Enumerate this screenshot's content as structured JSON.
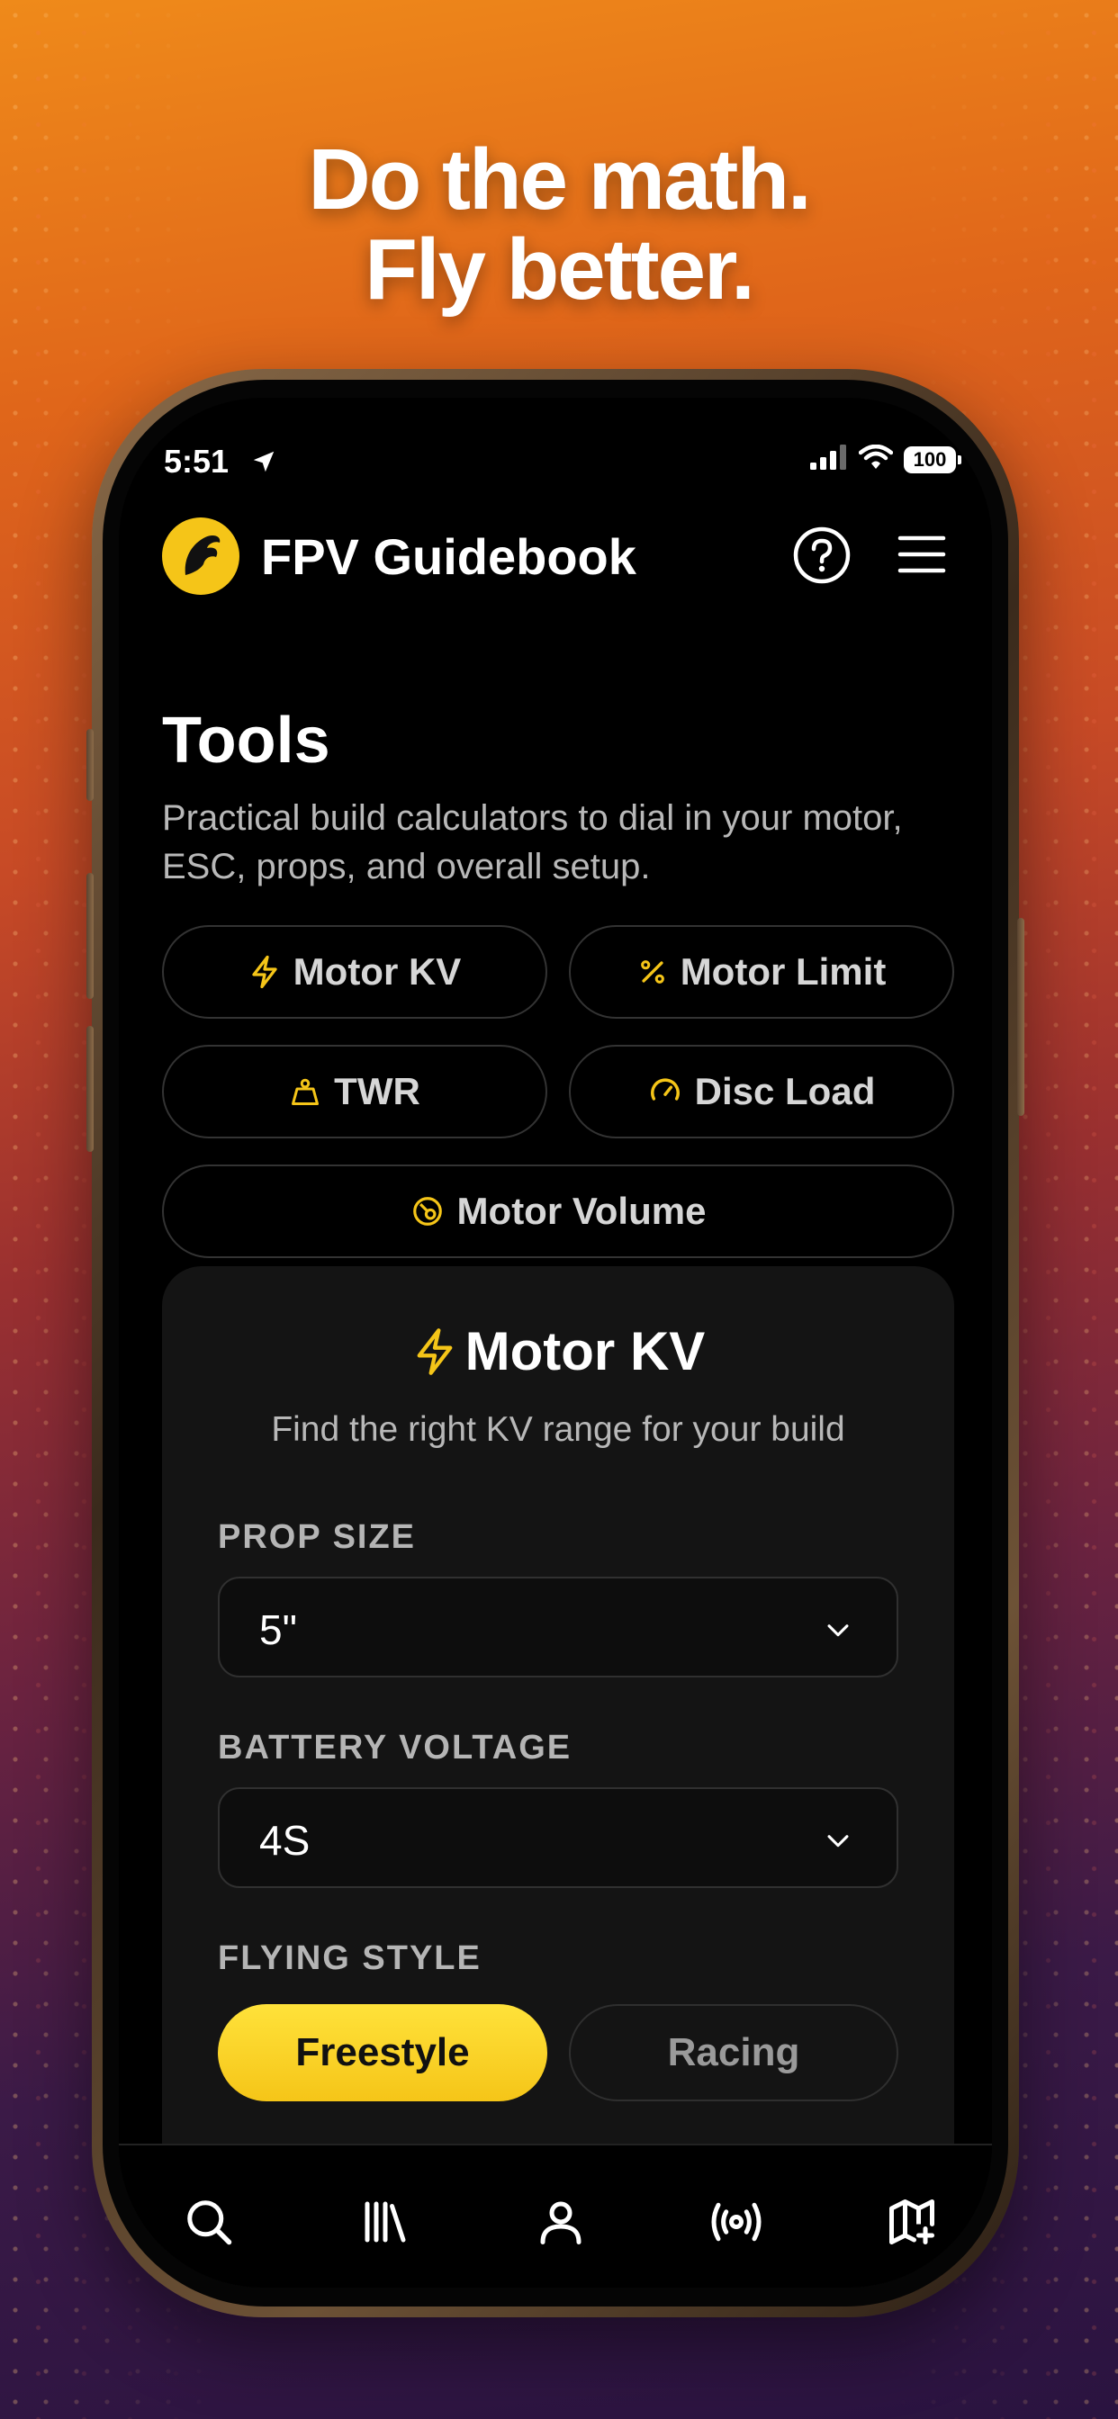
{
  "headline": {
    "line1": "Do the math.",
    "line2": "Fly better."
  },
  "status_bar": {
    "time": "5:51",
    "battery": "100"
  },
  "app_bar": {
    "title": "FPV Guidebook"
  },
  "page": {
    "title": "Tools",
    "description": "Practical build calculators to dial in your motor, ESC, props, and overall setup."
  },
  "tool_chips": [
    {
      "label": "Motor KV",
      "icon": "bolt-icon"
    },
    {
      "label": "Motor Limit",
      "icon": "percent-icon"
    },
    {
      "label": "TWR",
      "icon": "weight-icon"
    },
    {
      "label": "Disc Load",
      "icon": "gauge-icon"
    },
    {
      "label": "Motor Volume",
      "icon": "motor-icon"
    }
  ],
  "calculator": {
    "title": "Motor KV",
    "subtitle": "Find the right KV range for your build",
    "prop_size": {
      "label": "PROP SIZE",
      "value": "5\""
    },
    "battery_voltage": {
      "label": "BATTERY VOLTAGE",
      "value": "4S"
    },
    "flying_style": {
      "label": "FLYING STYLE",
      "options": [
        "Freestyle",
        "Racing"
      ],
      "selected": "Freestyle"
    }
  },
  "tab_bar": [
    "search-icon",
    "library-icon",
    "profile-icon",
    "broadcast-icon",
    "map-add-icon"
  ],
  "colors": {
    "accent": "#F5C518",
    "background": "#000000",
    "card": "#141414"
  }
}
